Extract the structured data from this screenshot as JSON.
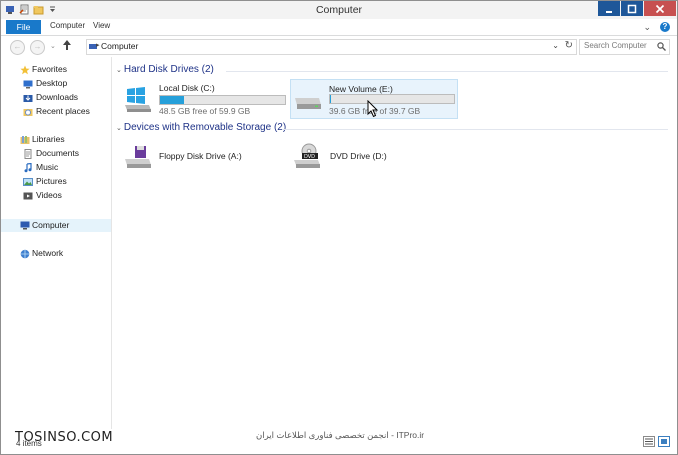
{
  "window": {
    "title": "Computer"
  },
  "ribbon": {
    "file_tab": "File",
    "tabs": [
      "Computer",
      "View"
    ]
  },
  "address": {
    "path": "Computer",
    "search_placeholder": "Search Computer"
  },
  "nav": {
    "favorites": "Favorites",
    "favorite_items": [
      "Desktop",
      "Downloads",
      "Recent places"
    ],
    "libraries": "Libraries",
    "library_items": [
      "Documents",
      "Music",
      "Pictures",
      "Videos"
    ],
    "computer": "Computer",
    "network": "Network"
  },
  "groups": {
    "hard_disks": "Hard Disk Drives (2)",
    "removable": "Devices with Removable Storage (2)"
  },
  "drives": [
    {
      "name": "Local Disk (C:)",
      "free_text": "48.5 GB free of 59.9 GB",
      "used_fraction": 0.19,
      "bar_color": "#26a0da"
    },
    {
      "name": "New Volume (E:)",
      "free_text": "39.6 GB free of 39.7 GB",
      "used_fraction": 0.003,
      "bar_color": "#26a0da"
    }
  ],
  "removable": [
    {
      "name": "Floppy Disk Drive (A:)"
    },
    {
      "name": "DVD Drive (D:)"
    }
  ],
  "status": {
    "count": "4 items"
  },
  "watermarks": {
    "left": "TOSINSO.COM",
    "center": "انجمن تخصصی فناوری اطلاعات ایران - ITPro.ir"
  },
  "colors": {
    "accent": "#1979ca",
    "close": "#c75050",
    "group_header": "#1e3287"
  }
}
